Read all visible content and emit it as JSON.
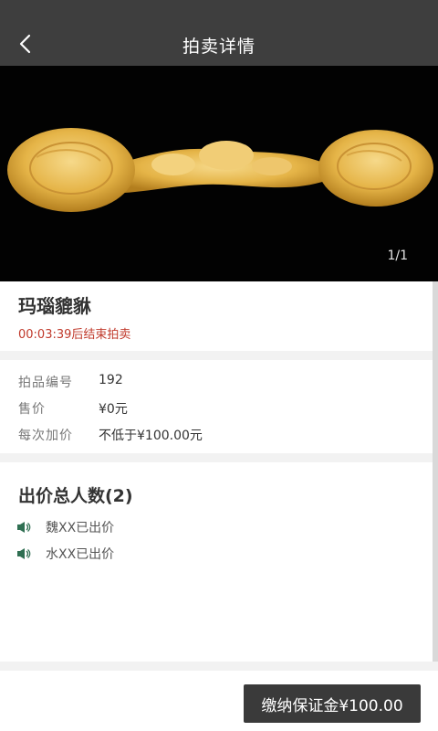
{
  "header": {
    "title": "拍卖详情",
    "back_icon": "chevron-left-icon"
  },
  "gallery": {
    "counter": "1/1",
    "image_subject": "ruyi-carving"
  },
  "item": {
    "name": "玛瑙貔貅",
    "countdown": "00:03:39后结束拍卖"
  },
  "details": [
    {
      "label": "拍品编号",
      "value": "192"
    },
    {
      "label": "售价",
      "value": "¥0元"
    },
    {
      "label": "每次加价",
      "value": "不低于¥100.00元"
    }
  ],
  "bids": {
    "title": "出价总人数(2)",
    "icon": "megaphone-icon",
    "entries": [
      {
        "text": "魏XX已出价"
      },
      {
        "text": "水XX已出价"
      }
    ]
  },
  "footer": {
    "pay_button": "缴纳保证金¥100.00"
  },
  "colors": {
    "header_bg": "#3e3e3e",
    "accent_red": "#c0392b",
    "button_bg": "#3a3a3a"
  }
}
